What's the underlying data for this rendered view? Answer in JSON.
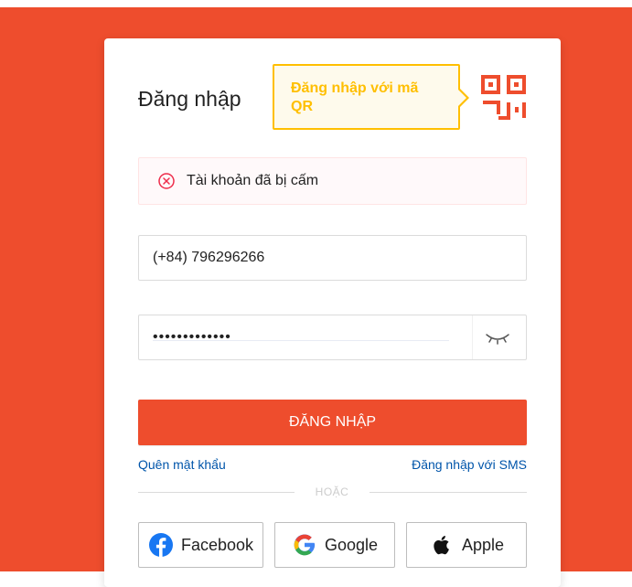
{
  "colors": {
    "brand": "#ee4d2d",
    "tooltip": "#ffbf00",
    "link": "#0055aa",
    "error": "#ee2c4a"
  },
  "login": {
    "title": "Đăng nhập",
    "qr_tooltip": "Đăng nhập với mã QR",
    "qr_icon": "qr-code-icon",
    "error_icon": "error-circle-x-icon",
    "error_message": "Tài khoản đã bị cấm",
    "phone_value": "(+84) 796296266",
    "password_value": "•••••••••••••",
    "eye_icon": "eye-closed-icon",
    "submit_label": "ĐĂNG NHẬP",
    "forgot_link": "Quên mật khẩu",
    "sms_link": "Đăng nhập với SMS",
    "divider_text": "HOẶC"
  },
  "social": {
    "facebook": {
      "label": "Facebook",
      "icon": "facebook-icon"
    },
    "google": {
      "label": "Google",
      "icon": "google-icon"
    },
    "apple": {
      "label": "Apple",
      "icon": "apple-icon"
    }
  }
}
